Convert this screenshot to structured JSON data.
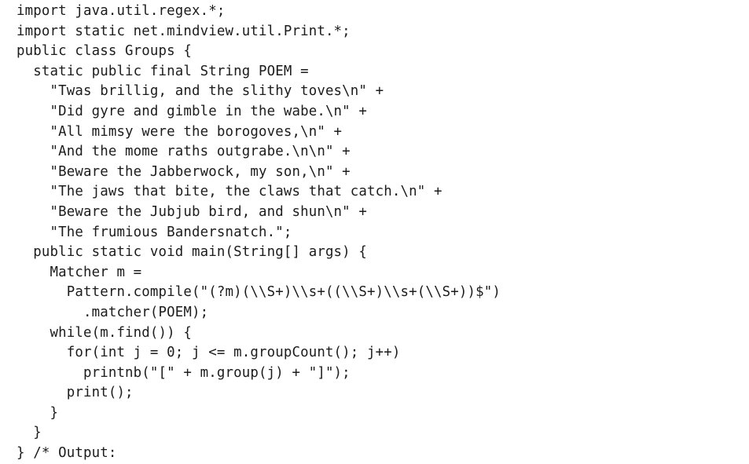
{
  "code": {
    "lines": [
      "import java.util.regex.*;",
      "import static net.mindview.util.Print.*;",
      "public class Groups {",
      "  static public final String POEM =",
      "    \"Twas brillig, and the slithy toves\\n\" +",
      "    \"Did gyre and gimble in the wabe.\\n\" +",
      "    \"All mimsy were the borogoves,\\n\" +",
      "    \"And the mome raths outgrabe.\\n\\n\" +",
      "    \"Beware the Jabberwock, my son,\\n\" +",
      "    \"The jaws that bite, the claws that catch.\\n\" +",
      "    \"Beware the Jubjub bird, and shun\\n\" +",
      "    \"The frumious Bandersnatch.\";",
      "  public static void main(String[] args) {",
      "    Matcher m =",
      "      Pattern.compile(\"(?m)(\\\\S+)\\\\s+((\\\\S+)\\\\s+(\\\\S+))$\")",
      "        .matcher(POEM);",
      "    while(m.find()) {",
      "      for(int j = 0; j <= m.groupCount(); j++)",
      "        printnb(\"[\" + m.group(j) + \"]\");",
      "      print();",
      "    }",
      "  }",
      "} /* Output:"
    ]
  }
}
